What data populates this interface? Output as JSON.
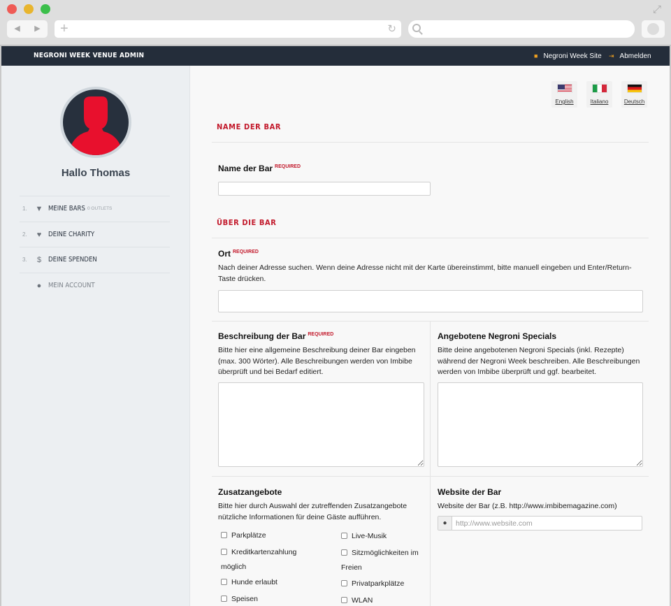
{
  "app": {
    "brand": "NEGRONI WEEK VENUE ADMIN",
    "links": {
      "site": "Negroni Week Site",
      "logout": "Abmelden"
    }
  },
  "sidebar": {
    "greeting": "Hallo Thomas",
    "items": [
      {
        "num": "1.",
        "icon": "cocktail-glass-icon",
        "label": "MEINE BARS",
        "badge": "0 OUTLETS"
      },
      {
        "num": "2.",
        "icon": "heart-icon",
        "label": "DEINE CHARITY"
      },
      {
        "num": "3.",
        "icon": "dollar-icon",
        "label": "DEINE SPENDEN"
      },
      {
        "num": "",
        "icon": "user-icon",
        "label": "MEIN ACCOUNT"
      }
    ]
  },
  "languages": [
    {
      "code": "us",
      "label": "English"
    },
    {
      "code": "it",
      "label": "Italiano"
    },
    {
      "code": "de",
      "label": "Deutsch"
    }
  ],
  "form": {
    "section1": "NAME DER BAR",
    "name": {
      "label": "Name der Bar",
      "required": "REQUIRED"
    },
    "section2": "ÜBER DIE BAR",
    "location": {
      "label": "Ort",
      "required": "REQUIRED",
      "help": "Nach deiner Adresse suchen. Wenn deine Adresse nicht mit der Karte übereinstimmt, bitte manuell eingeben und Enter/Return-Taste drücken."
    },
    "description": {
      "label": "Beschreibung der Bar",
      "required": "REQUIRED",
      "help": "Bitte hier eine allgemeine Beschreibung deiner Bar eingeben (max. 300 Wörter). Alle Beschreibungen werden von Imbibe überprüft und bei Bedarf editiert."
    },
    "specials": {
      "label": "Angebotene Negroni Specials",
      "help": "Bitte deine angebotenen Negroni Specials (inkl. Rezepte) während der Negroni Week beschreiben. Alle Beschreibungen werden von Imbibe überprüft und ggf. bearbeitet."
    },
    "extras": {
      "label": "Zusatzangebote",
      "help": "Bitte hier durch Auswahl der zutreffenden Zusatzangebote nützliche Informationen für deine Gäste aufführen.",
      "col1": [
        "Parkplätze",
        "Kreditkartenzahlung",
        "möglich",
        "Hunde erlaubt",
        "Speisen"
      ],
      "col2": [
        "Live-Musik",
        "Sitzmöglichkeiten im",
        "Freien",
        "Privatparkplätze",
        "WLAN"
      ]
    },
    "website": {
      "label": "Website der Bar",
      "help": "Website der Bar (z.B. http://www.imbibemagazine.com)",
      "placeholder": "http://www.website.com"
    }
  }
}
